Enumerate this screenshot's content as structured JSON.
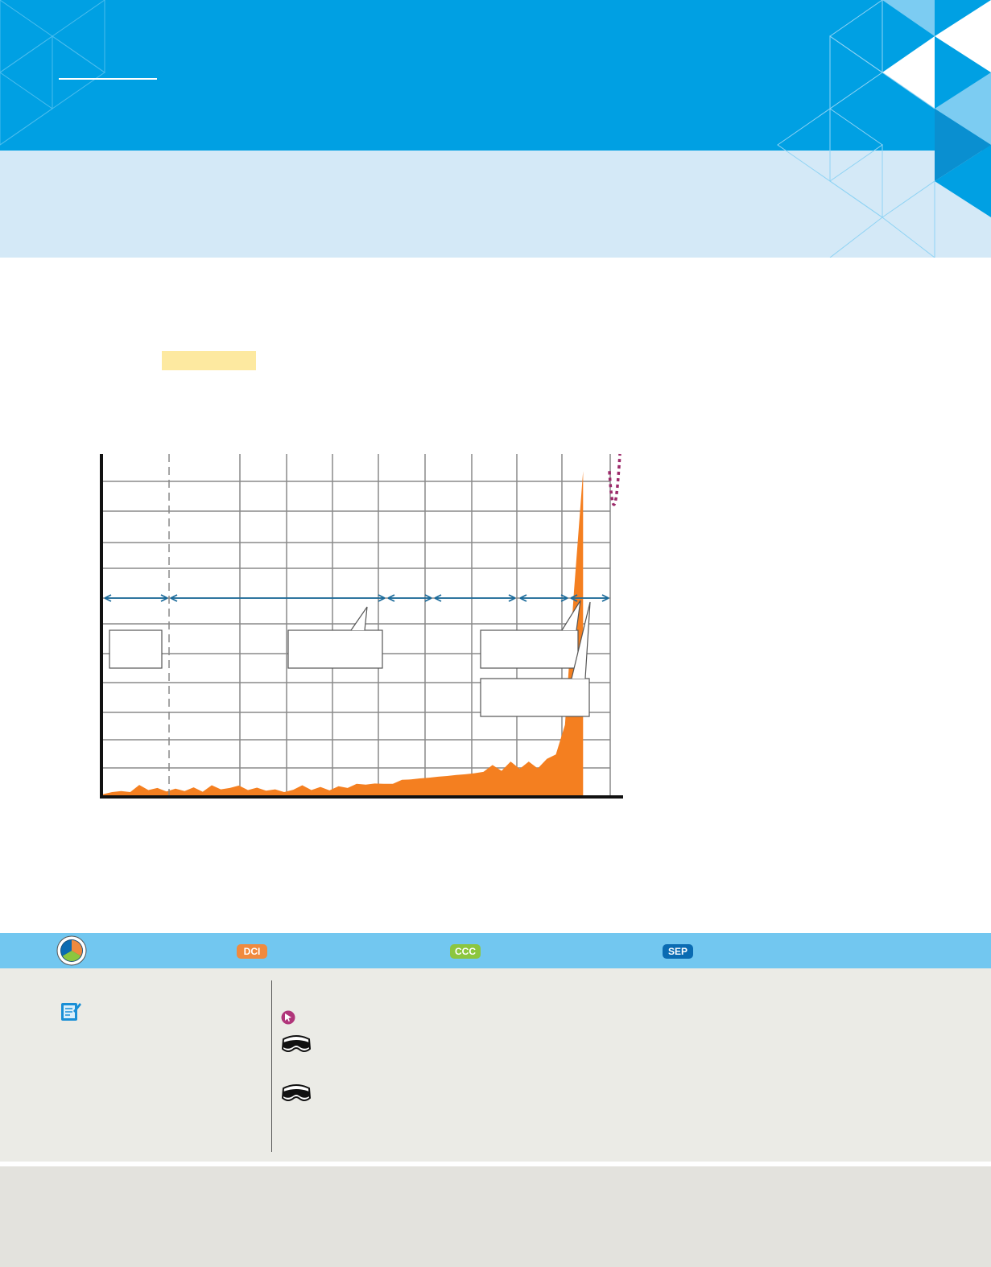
{
  "colors": {
    "header": "#00a0e3",
    "header_sub": "#d4e9f7",
    "highlight": "#fde9a0",
    "standards_bar": "#72c7f0",
    "dci": "#f08a3e",
    "ccc": "#8cc63f",
    "sep": "#0a6bb2",
    "area_fill": "#f47f20",
    "dotted_line": "#9c2a6a",
    "arrow": "#1a6a9a",
    "notes_panel": "#ebebe6",
    "footer": "#e3e2dd"
  },
  "standards": {
    "dci_label": "DCI",
    "ccc_label": "CCC",
    "sep_label": "SEP"
  },
  "icons": {
    "dimension": "three-dimensions-icon",
    "notebook": "notebook-icon",
    "cursor": "cursor-icon",
    "goggles": "safety-goggles-icon"
  },
  "chart_data": {
    "type": "area",
    "title": "",
    "xlabel": "",
    "ylabel": "",
    "grid": true,
    "x": [
      0,
      1,
      2,
      3,
      4,
      5,
      6,
      7,
      8,
      9,
      10,
      11,
      12,
      13,
      14,
      15,
      16,
      17,
      18,
      19,
      20,
      21,
      22,
      23,
      24,
      25,
      26,
      27,
      28,
      29,
      30,
      31,
      32,
      33,
      34,
      35,
      36,
      37,
      38,
      39,
      40,
      41,
      42,
      43,
      44,
      45,
      46,
      47,
      48,
      49,
      50,
      51,
      52,
      53
    ],
    "values": [
      0.8,
      1.4,
      1.7,
      1.4,
      3.5,
      2.0,
      2.6,
      1.6,
      2.4,
      1.7,
      2.8,
      1.5,
      3.4,
      2.2,
      2.6,
      3.3,
      2.0,
      2.7,
      1.8,
      2.2,
      1.4,
      2.1,
      3.4,
      2.0,
      2.9,
      1.9,
      3.1,
      2.6,
      3.8,
      3.6,
      3.9,
      3.8,
      3.8,
      5.0,
      5.1,
      5.4,
      5.6,
      5.9,
      6.1,
      6.4,
      6.6,
      6.9,
      7.3,
      9.3,
      7.6,
      10.3,
      8.2,
      10.3,
      8.3,
      11.1,
      12.4,
      21.0,
      60.0,
      95.0
    ],
    "ylim": [
      0,
      100
    ],
    "xlim": [
      0,
      56
    ]
  }
}
